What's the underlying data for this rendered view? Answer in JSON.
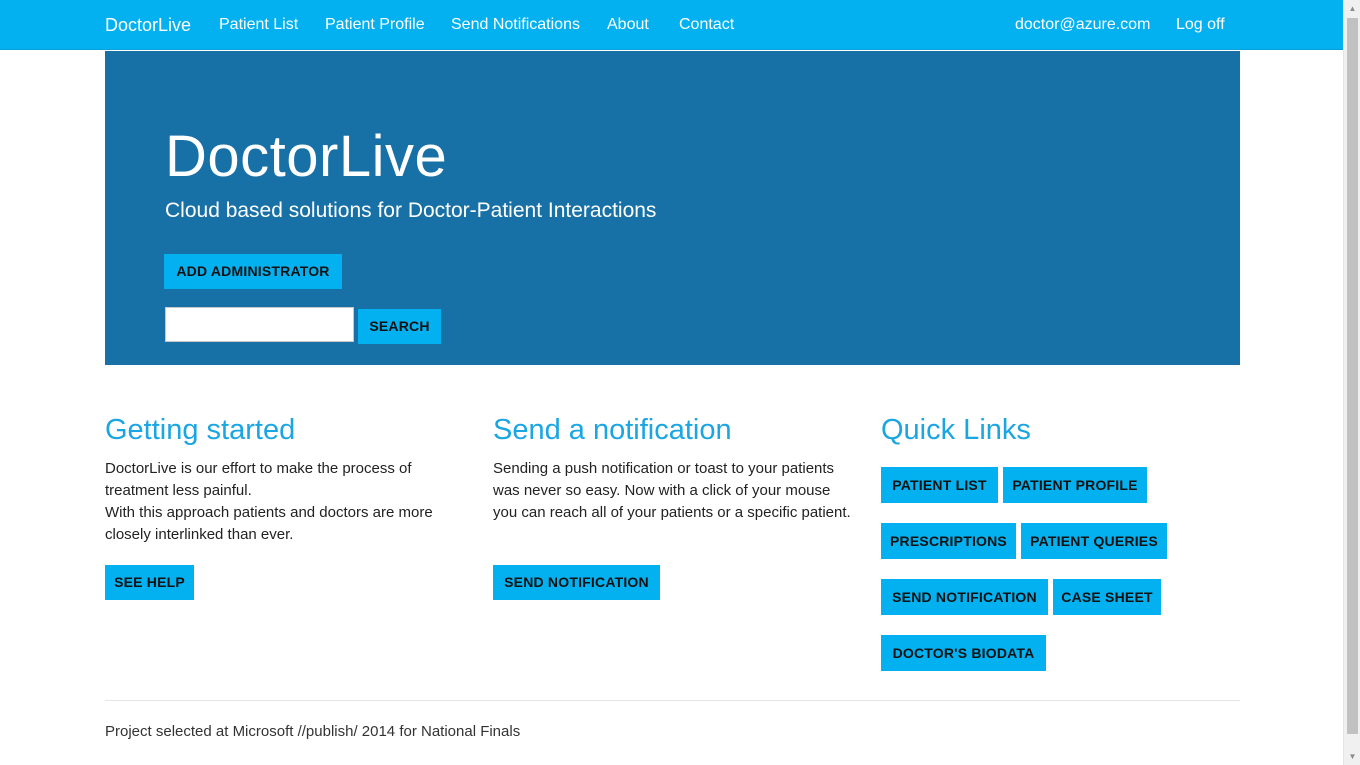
{
  "navbar": {
    "brand": "DoctorLive",
    "links": [
      "Patient List",
      "Patient Profile",
      "Send Notifications",
      "About",
      "Contact"
    ],
    "user_email": "doctor@azure.com",
    "logoff": "Log off",
    "bg_color": "#03b1f0"
  },
  "hero": {
    "title": "DoctorLive",
    "subtitle": "Cloud based solutions for Doctor-Patient Interactions",
    "add_admin_label": "ADD ADMINISTRATOR",
    "search_value": "",
    "search_label": "SEARCH",
    "bg_color": "#1770a6"
  },
  "getting_started": {
    "title": "Getting started",
    "line1": "DoctorLive is our effort to make the process of treatment less painful.",
    "line2": "With this approach patients and doctors are more closely interlinked than ever.",
    "button": "SEE HELP"
  },
  "notification": {
    "title": "Send a notification",
    "text": "Sending a push notification or toast to your patients was never so easy. Now with a click of your mouse you can reach all of your patients or a specific patient.",
    "button": "SEND NOTIFICATION"
  },
  "quick_links": {
    "title": "Quick Links",
    "items": [
      "PATIENT LIST",
      "PATIENT PROFILE",
      "PRESCRIPTIONS",
      "PATIENT QUERIES",
      "SEND NOTIFICATION",
      "CASE SHEET",
      "DOCTOR'S BIODATA"
    ]
  },
  "footer": {
    "text": "Project selected at Microsoft //publish/ 2014 for National Finals"
  },
  "colors": {
    "accent": "#03b1f0",
    "heading": "#1aa5e3"
  }
}
